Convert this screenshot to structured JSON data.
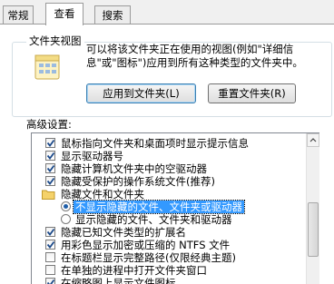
{
  "tabs": [
    "常规",
    "查看",
    "搜索"
  ],
  "active_tab": "查看",
  "folder_views": {
    "title": "文件夹视图",
    "description": "可以将该文件夹正在使用的视图(例如\"详细信息\"或\"图标\")应用到所有这种类型的文件夹中。",
    "apply_button": "应用到文件夹(L)",
    "reset_button": "重置文件夹(R)"
  },
  "advanced": {
    "title": "高级设置:",
    "items": [
      {
        "type": "checkbox",
        "checked": true,
        "label": "鼠标指向文件夹和桌面项时显示提示信息"
      },
      {
        "type": "checkbox",
        "checked": true,
        "label": "显示驱动器号"
      },
      {
        "type": "checkbox",
        "checked": true,
        "label": "隐藏计算机文件夹中的空驱动器"
      },
      {
        "type": "checkbox",
        "checked": true,
        "label": "隐藏受保护的操作系统文件(推荐)"
      },
      {
        "type": "folder",
        "label": "隐藏文件和文件夹"
      },
      {
        "type": "radio",
        "checked": true,
        "label": "不显示隐藏的文件、文件夹或驱动器",
        "selected": true
      },
      {
        "type": "radio",
        "checked": false,
        "label": "显示隐藏的文件、文件夹和驱动器"
      },
      {
        "type": "checkbox",
        "checked": true,
        "label": "隐藏已知文件类型的扩展名"
      },
      {
        "type": "checkbox",
        "checked": true,
        "label": "用彩色显示加密或压缩的 NTFS 文件"
      },
      {
        "type": "checkbox",
        "checked": false,
        "label": "在标题栏显示完整路径(仅限经典主题)"
      },
      {
        "type": "checkbox",
        "checked": false,
        "label": "在单独的进程中打开文件夹窗口"
      },
      {
        "type": "checkbox",
        "checked": true,
        "label": "在缩略图上显示文件图标"
      }
    ]
  }
}
